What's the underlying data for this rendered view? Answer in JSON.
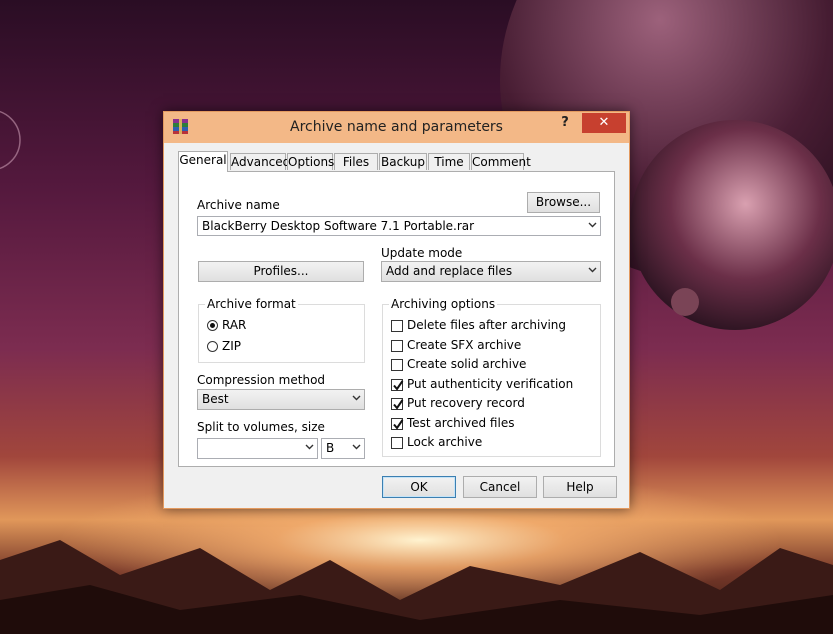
{
  "window": {
    "title": "Archive name and parameters",
    "help": "?",
    "close": "✕"
  },
  "tabs": [
    "General",
    "Advanced",
    "Options",
    "Files",
    "Backup",
    "Time",
    "Comment"
  ],
  "general": {
    "archive_name_label": "Archive name",
    "browse_label": "Browse...",
    "archive_name_value": "BlackBerry Desktop Software 7.1 Portable.rar",
    "profiles_label": "Profiles...",
    "update_mode_label": "Update mode",
    "update_mode_value": "Add and replace files",
    "archive_format": {
      "label": "Archive format",
      "options": [
        "RAR",
        "ZIP"
      ],
      "selected": "RAR"
    },
    "compression_label": "Compression method",
    "compression_value": "Best",
    "split_label": "Split to volumes, size",
    "split_value": "",
    "split_unit": "B",
    "archiving_options": {
      "label": "Archiving options",
      "items": [
        {
          "label": "Delete files after archiving",
          "checked": false
        },
        {
          "label": "Create SFX archive",
          "checked": false
        },
        {
          "label": "Create solid archive",
          "checked": false
        },
        {
          "label": "Put authenticity verification",
          "checked": true
        },
        {
          "label": "Put recovery record",
          "checked": true
        },
        {
          "label": "Test archived files",
          "checked": true
        },
        {
          "label": "Lock archive",
          "checked": false
        }
      ]
    }
  },
  "footer": {
    "ok": "OK",
    "cancel": "Cancel",
    "help": "Help"
  },
  "colors": {
    "titlebar": "#f3b887",
    "close": "#c7402f",
    "border": "#e39a5f"
  }
}
